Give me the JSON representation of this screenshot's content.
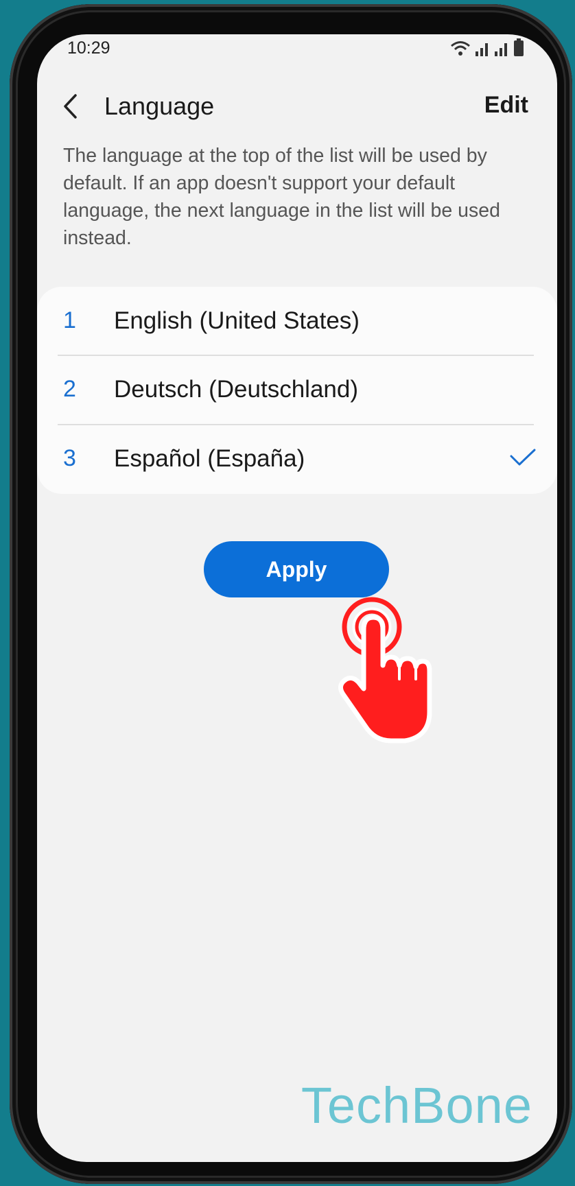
{
  "status_bar": {
    "time": "10:29",
    "icons": [
      "wifi-icon",
      "signal-icon",
      "signal-icon",
      "battery-icon"
    ]
  },
  "app_bar": {
    "title": "Language",
    "edit_label": "Edit",
    "back_icon": "chevron-left-icon"
  },
  "description": "The language at the top of the list will be used by default. If an app doesn't support your default language, the next language in the list will be used instead.",
  "languages": [
    {
      "index": "1",
      "name": "English (United States)",
      "selected": false
    },
    {
      "index": "2",
      "name": "Deutsch (Deutschland)",
      "selected": false
    },
    {
      "index": "3",
      "name": "Español (España)",
      "selected": true
    }
  ],
  "apply_label": "Apply",
  "watermark": "TechBone",
  "colors": {
    "accent": "#0c6fd8",
    "background": "#f2f2f2",
    "card": "#fbfbfb",
    "pointer_hand": "#ff1e1e",
    "watermark": "#6cc5d3"
  }
}
